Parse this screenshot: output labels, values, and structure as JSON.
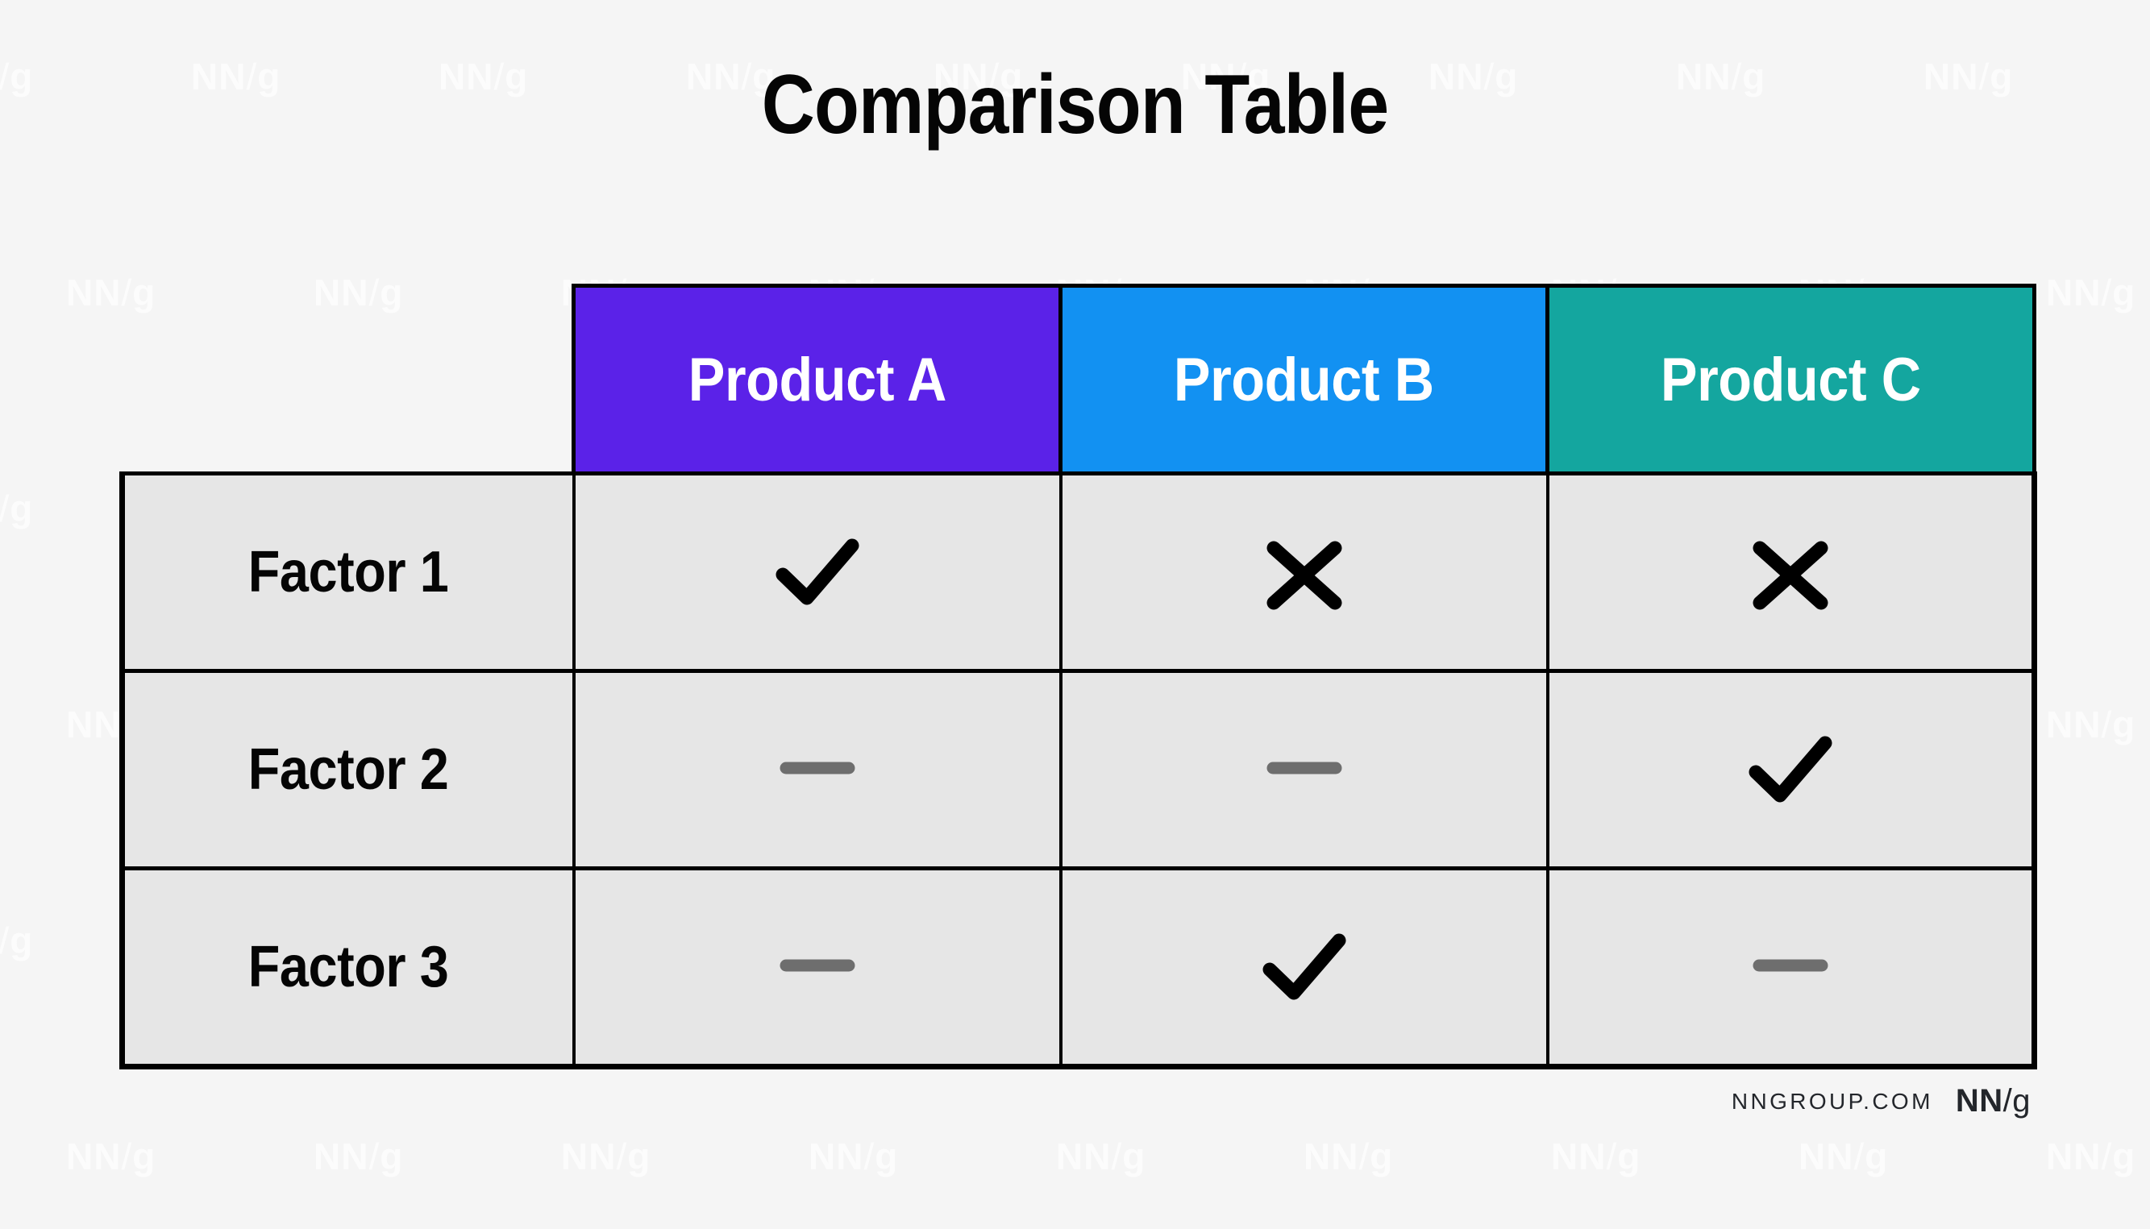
{
  "title": "Comparison Table",
  "background_color": "#f5f5f5",
  "table": {
    "cell_background": "#e6e6e6",
    "border_color": "#000000",
    "corner_header": "",
    "column_headers": [
      {
        "label": "Product A",
        "color": "#5B22E8"
      },
      {
        "label": "Product B",
        "color": "#1291F2"
      },
      {
        "label": "Product C",
        "color": "#14A69F"
      }
    ],
    "rows": [
      {
        "label": "Factor 1",
        "cells": [
          {
            "mark": "check",
            "icon": "check-icon"
          },
          {
            "mark": "cross",
            "icon": "cross-icon"
          },
          {
            "mark": "cross",
            "icon": "cross-icon"
          }
        ]
      },
      {
        "label": "Factor 2",
        "cells": [
          {
            "mark": "dash",
            "icon": "dash-icon"
          },
          {
            "mark": "dash",
            "icon": "dash-icon"
          },
          {
            "mark": "check",
            "icon": "check-icon"
          }
        ]
      },
      {
        "label": "Factor 3",
        "cells": [
          {
            "mark": "dash",
            "icon": "dash-icon"
          },
          {
            "mark": "check",
            "icon": "check-icon"
          },
          {
            "mark": "dash",
            "icon": "dash-icon"
          }
        ]
      }
    ],
    "mark_colors": {
      "check": "#000000",
      "cross": "#000000",
      "dash": "#6E6E6E"
    }
  },
  "footer": {
    "url": "NNGROUP.COM",
    "logo_nn": "NN",
    "logo_slash": "/",
    "logo_g": "g"
  },
  "watermark": {
    "nn": "NN",
    "slash": "/",
    "g": "g"
  }
}
